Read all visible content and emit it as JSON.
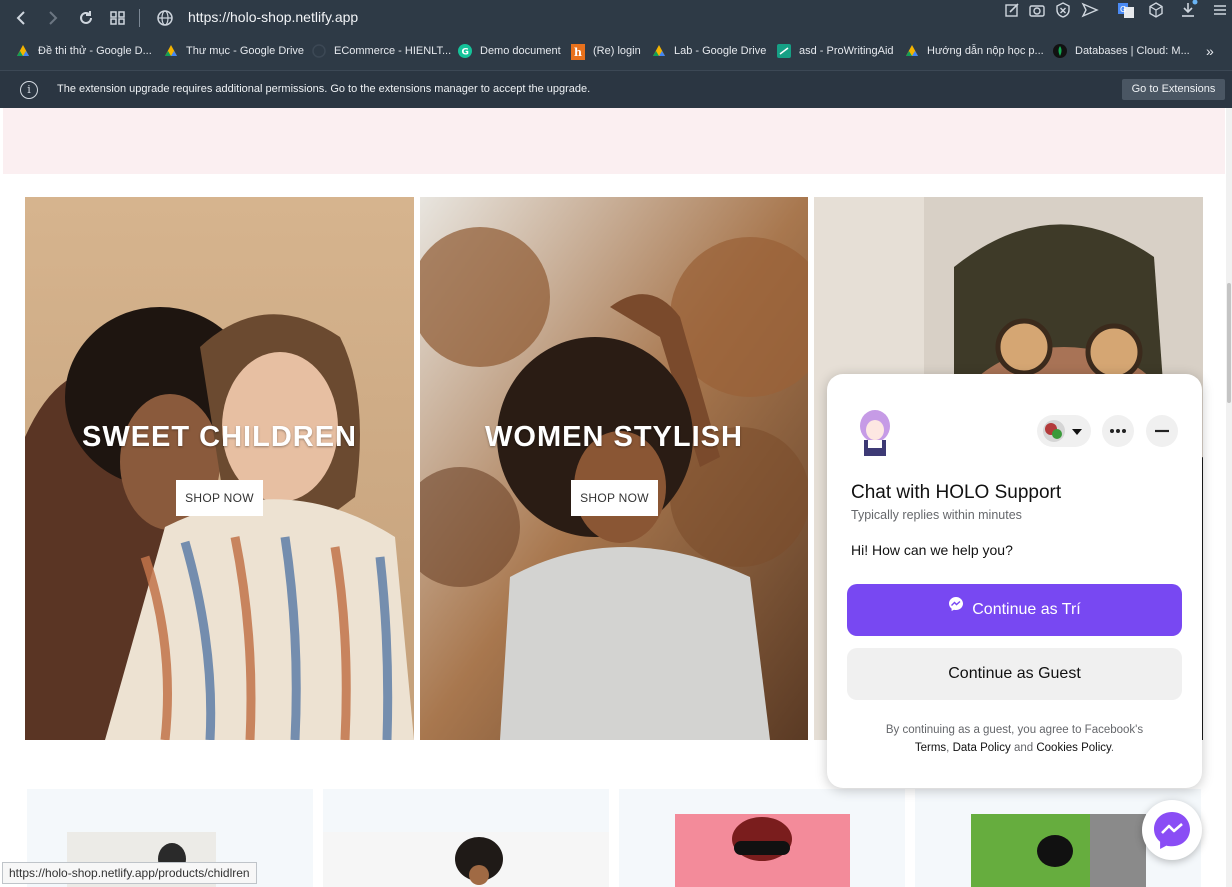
{
  "browser": {
    "url": "https://holo-shop.netlify.app",
    "bookmarks": [
      {
        "label": "Đề thi thử - Google D...",
        "icon": "google-drive-icon"
      },
      {
        "label": "Thư mục - Google Drive",
        "icon": "google-drive-icon"
      },
      {
        "label": "ECommerce - HIENLT...",
        "icon": "wordpress-icon"
      },
      {
        "label": "Demo document",
        "icon": "grammarly-icon"
      },
      {
        "label": "(Re) login",
        "icon": "h-icon"
      },
      {
        "label": "Lab - Google Drive",
        "icon": "google-drive-icon"
      },
      {
        "label": "asd - ProWritingAid",
        "icon": "prowritingaid-icon"
      },
      {
        "label": "Hướng dẫn nộp học p...",
        "icon": "google-drive-icon"
      },
      {
        "label": "Databases | Cloud: M...",
        "icon": "mongodb-icon"
      }
    ],
    "infobar_text": "The extension upgrade requires additional permissions. Go to the extensions manager to accept the upgrade.",
    "infobar_button": "Go to Extensions",
    "status_url": "https://holo-shop.netlify.app/products/chidlren"
  },
  "banners": [
    {
      "title": "SWEET CHILDREN",
      "button": "SHOP NOW"
    },
    {
      "title": "WOMEN STYLISH",
      "button": "SHOP NOW"
    }
  ],
  "chat": {
    "title": "Chat with HOLO Support",
    "subtitle": "Typically replies within minutes",
    "greeting": "Hi! How can we help you?",
    "primary_button": "Continue as Trí",
    "secondary_button": "Continue as Guest",
    "legal_prefix": "By continuing as a guest, you agree to Facebook's",
    "legal_terms": "Terms",
    "legal_comma": ",",
    "legal_data": "Data Policy",
    "legal_and": "and",
    "legal_cookies": "Cookies Policy",
    "legal_dot": "."
  },
  "colors": {
    "browser_bg": "#2e3a46",
    "messenger_purple": "#7848f2",
    "pink_band": "#fbeff1"
  }
}
